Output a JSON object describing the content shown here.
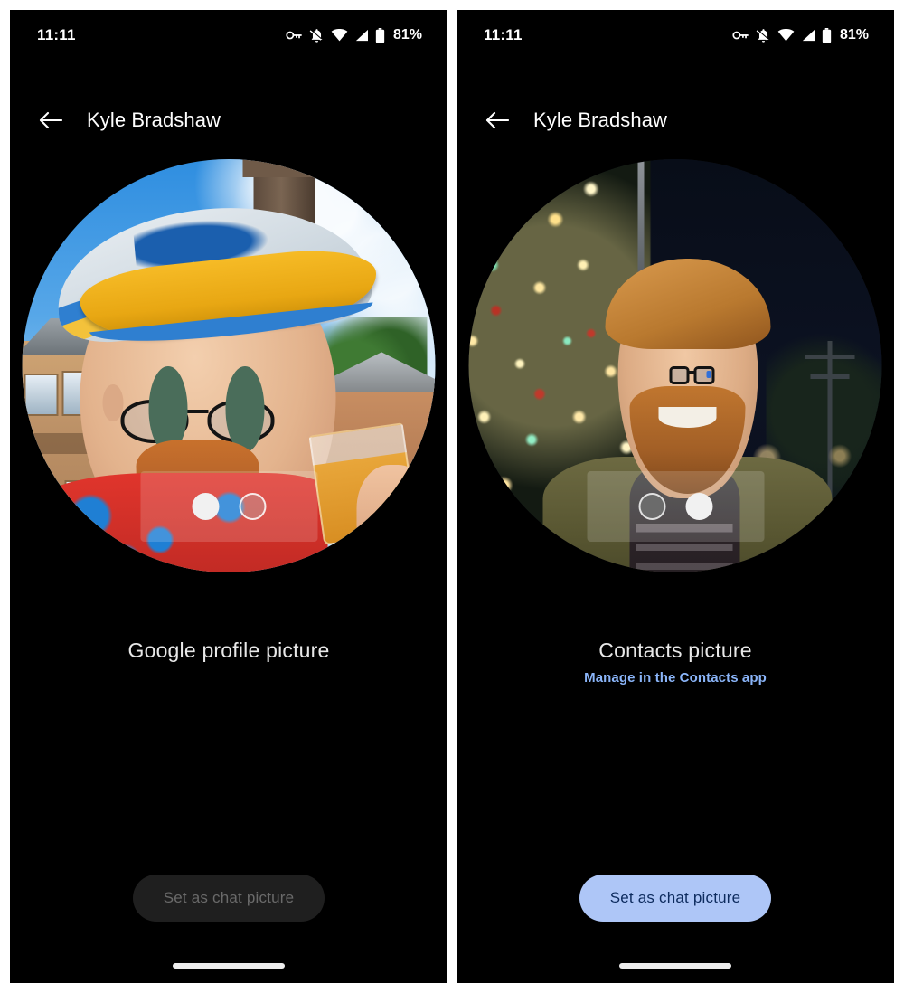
{
  "screens": [
    {
      "id": "google-profile-picture-screen",
      "status_bar": {
        "time": "11:11",
        "icons": [
          "vpn-key-icon",
          "notifications-off-icon",
          "wifi-icon",
          "cell-signal-icon",
          "battery-icon"
        ],
        "battery_percent": "81%"
      },
      "app_bar": {
        "back_icon": "arrow-back-icon",
        "title": "Kyle Bradshaw"
      },
      "avatar": {
        "photo_description": "Man with ginger beard and glasses wearing a yellow and blue cap and red patterned shirt, holding a glass of beer at a theme park",
        "time_of_day": "day"
      },
      "page_dots": {
        "count": 2,
        "active_index": 0
      },
      "caption": {
        "title": "Google profile picture",
        "link": ""
      },
      "cta": {
        "label": "Set as chat picture",
        "enabled": false
      }
    },
    {
      "id": "contacts-picture-screen",
      "status_bar": {
        "time": "11:11",
        "icons": [
          "vpn-key-icon",
          "notifications-off-icon",
          "wifi-icon",
          "cell-signal-icon",
          "battery-icon"
        ],
        "battery_percent": "81%"
      },
      "app_bar": {
        "back_icon": "arrow-back-icon",
        "title": "Kyle Bradshaw"
      },
      "avatar": {
        "photo_description": "Man with ginger beard and glasses in an olive jacket standing at night in front of a lit Christmas tree",
        "time_of_day": "night"
      },
      "page_dots": {
        "count": 2,
        "active_index": 1
      },
      "caption": {
        "title": "Contacts picture",
        "link": "Manage in the Contacts app"
      },
      "cta": {
        "label": "Set as chat picture",
        "enabled": true
      }
    }
  ],
  "colors": {
    "screen_background": "#000000",
    "page_background": "#ffffff",
    "primary_text": "#ffffff",
    "caption_text": "#e8e8e8",
    "link_blue": "#8ab4f8",
    "cta_enabled_bg": "#aec6f7",
    "cta_enabled_text": "#0d2b5e",
    "cta_disabled_bg": "#1f1f1f",
    "cta_disabled_text": "#6a6a6a"
  }
}
